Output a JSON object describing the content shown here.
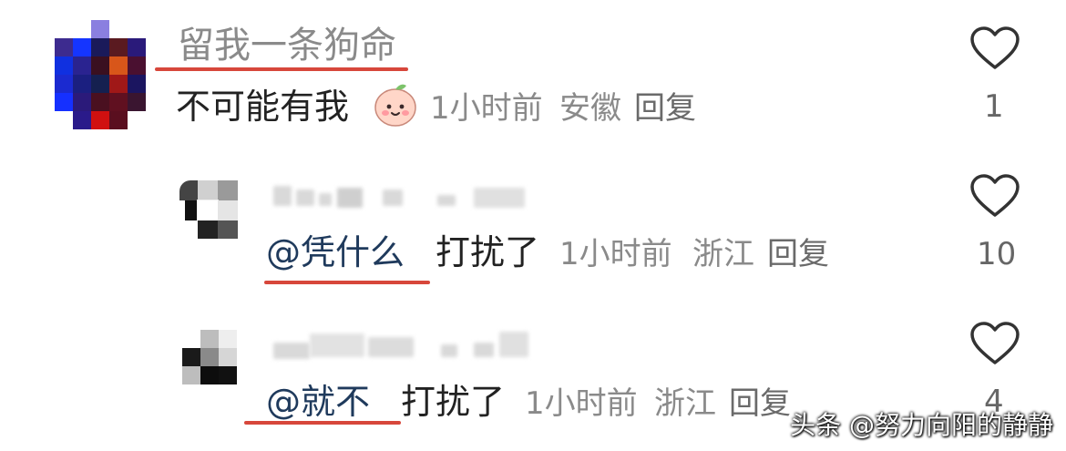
{
  "comments": [
    {
      "username": "留我一条狗命",
      "text": "不可能有我",
      "time": "1小时前",
      "location": "安徽",
      "reply_label": "回复",
      "like_count": "1"
    },
    {
      "mention": "@凭什么",
      "text": "打扰了",
      "time": "1小时前",
      "location": "浙江",
      "reply_label": "回复",
      "like_count": "10"
    },
    {
      "mention": "@就不",
      "text": "打扰了",
      "time": "1小时前",
      "location": "浙江",
      "reply_label": "回复",
      "like_count": "4"
    }
  ],
  "watermark": "头条 @努力向阳的静静",
  "colors": {
    "accent_underline": "#d7473b",
    "mention": "#1f3a5c",
    "meta": "#8a8a8a"
  },
  "icons": {
    "like": "heart-outline-icon",
    "emoji": "smiling-peach-emoji"
  }
}
